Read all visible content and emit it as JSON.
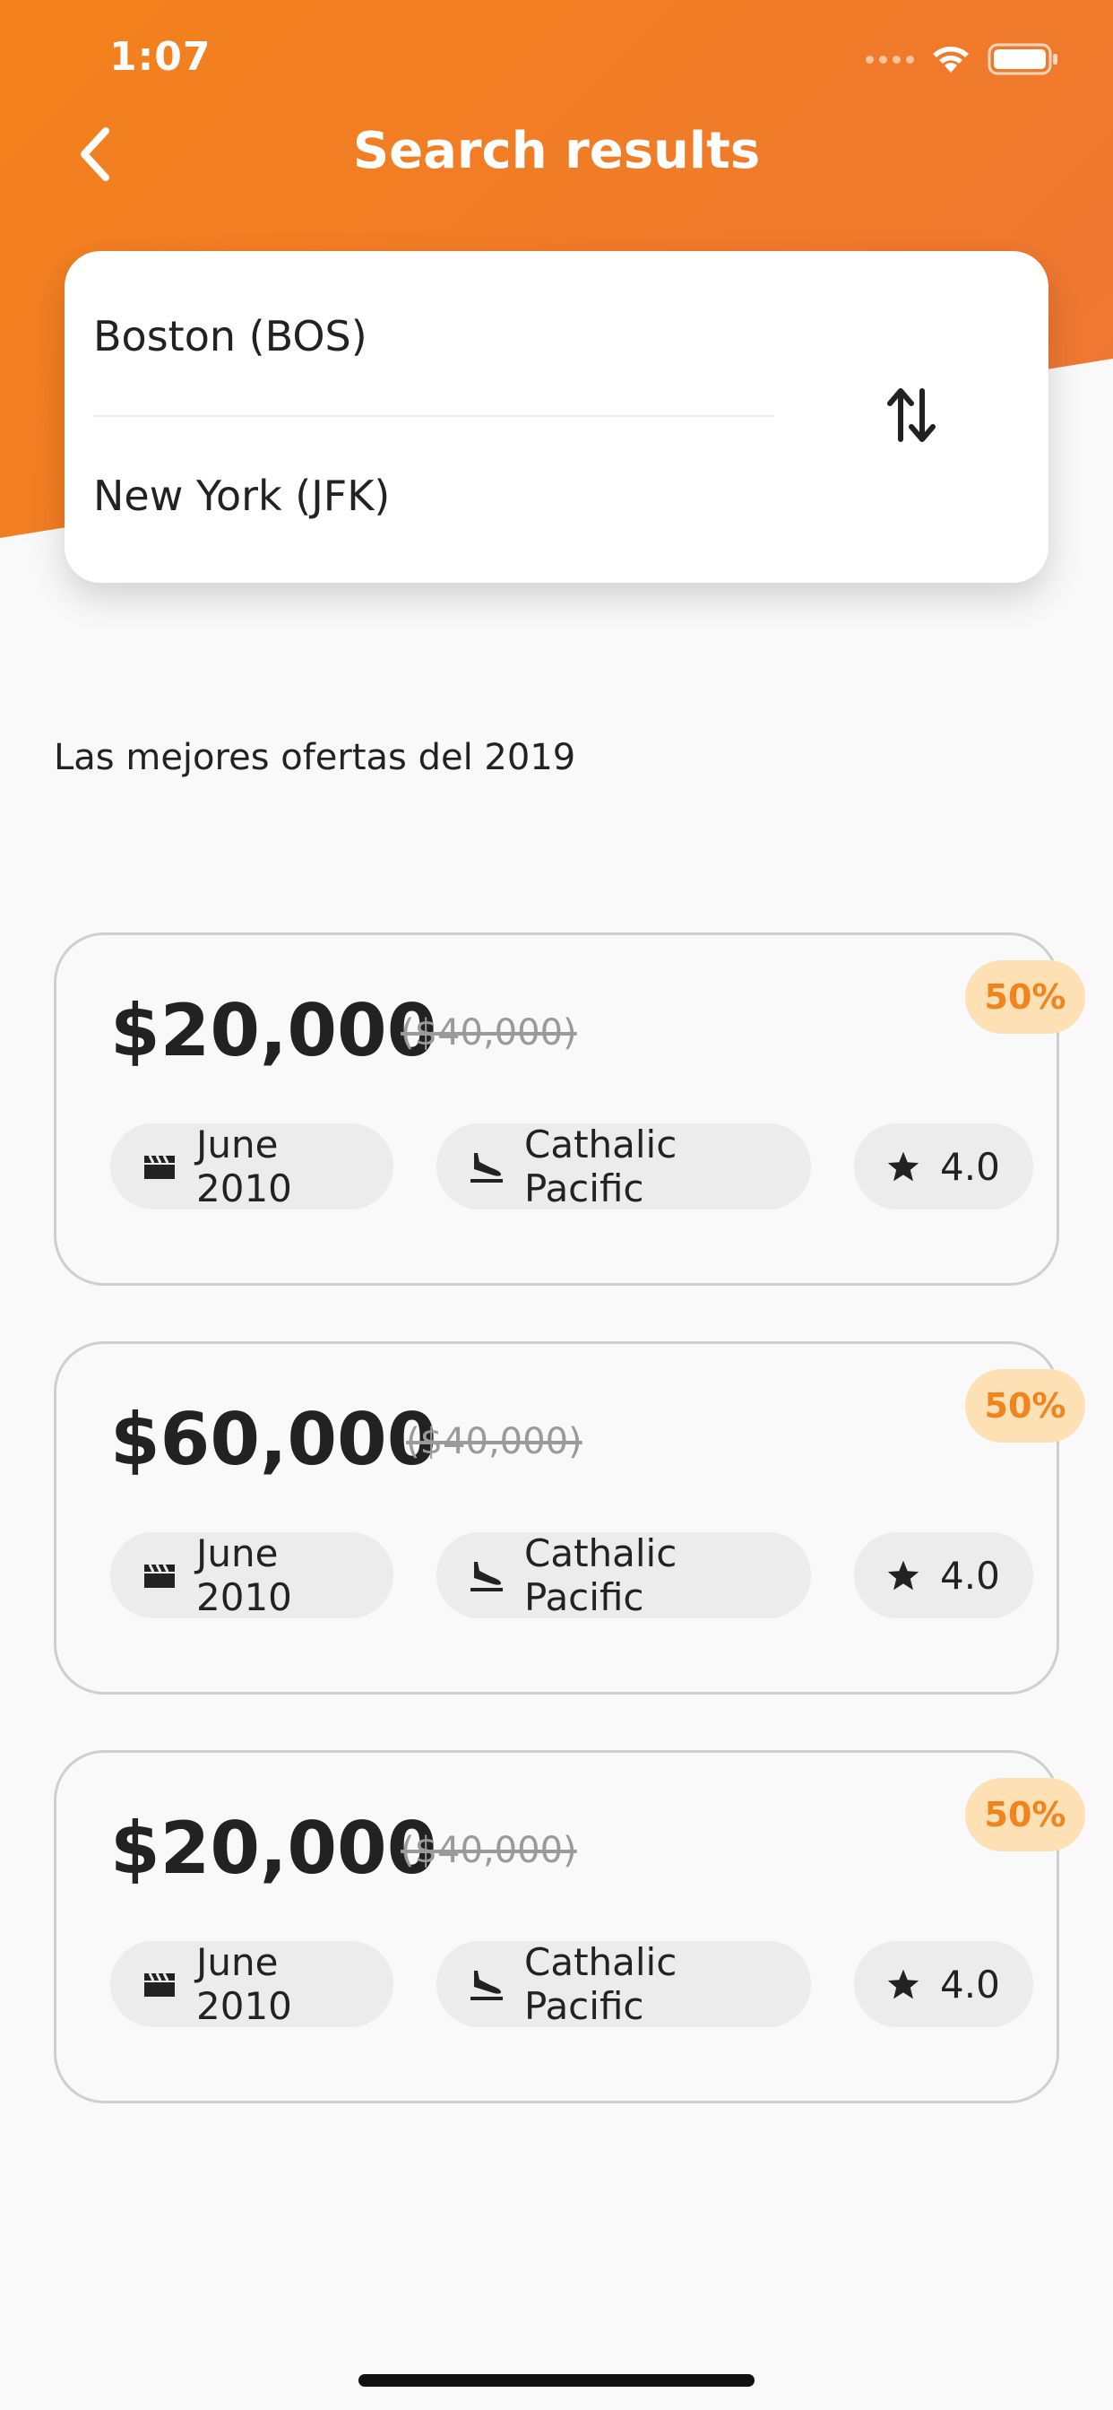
{
  "status_bar": {
    "time": "1:07",
    "icons": [
      "signal-dots-icon",
      "wifi-icon",
      "battery-icon"
    ]
  },
  "header": {
    "title": "Search results",
    "back_icon": "chevron-left-icon",
    "accent_color": "#f4821c"
  },
  "route": {
    "from": "Boston (BOS)",
    "to": "New York (JFK)",
    "swap_icon": "swap-vertical-icon"
  },
  "section_heading": "Las mejores ofertas del 2019",
  "offers": [
    {
      "price": "$20,000",
      "old_price": "($40,000)",
      "discount": "50%",
      "date": "June 2010",
      "airline": "Cathalic Pacific",
      "rating": "4.0"
    },
    {
      "price": "$60,000",
      "old_price": "($40,000)",
      "discount": "50%",
      "date": "June 2010",
      "airline": "Cathalic Pacific",
      "rating": "4.0"
    },
    {
      "price": "$20,000",
      "old_price": "($40,000)",
      "discount": "50%",
      "date": "June 2010",
      "airline": "Cathalic Pacific",
      "rating": "4.0"
    }
  ],
  "colors": {
    "badge_bg": "#fde0b4",
    "badge_text": "#f0841f",
    "chip_bg": "#ececec",
    "page_bg": "#f9f9f9"
  }
}
